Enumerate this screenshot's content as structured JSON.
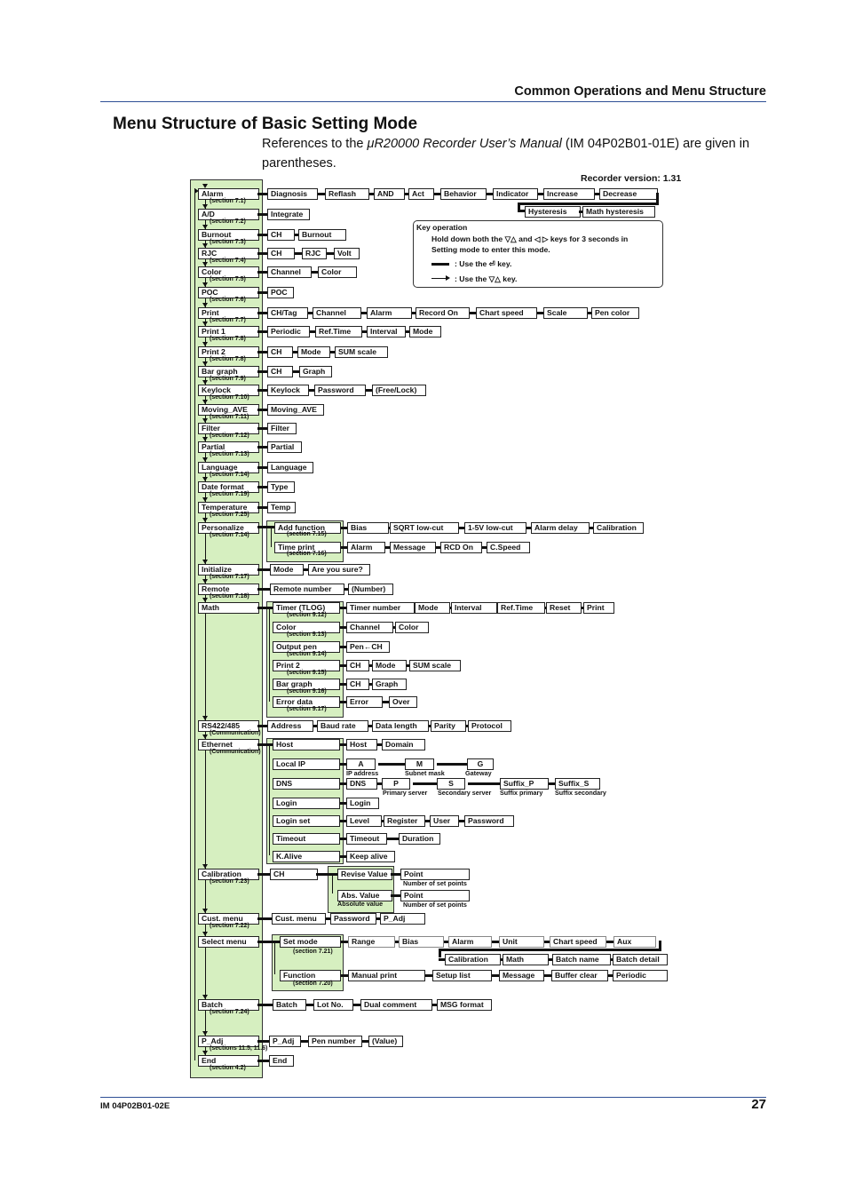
{
  "header": {
    "section_title": "Common Operations and Menu Structure",
    "page_title": "Menu Structure of Basic Setting Mode",
    "intro_prefix": "References to the ",
    "intro_italic": "μR20000 Recorder User’s Manual",
    "intro_suffix": " (IM 04P02B01-01E) are given in parentheses.",
    "recorder_version": "Recorder version: 1.31"
  },
  "key_operation": {
    "title": "Key operation",
    "line1": "Hold down both the ▽△ and ◁ ▷ keys for 3 seconds in",
    "line2": "Setting mode to enter this mode.",
    "thick_legend": ":  Use the ⏎ key.",
    "thin_legend": ":  Use the ▽△ key."
  },
  "menu": {
    "alarm": {
      "label": "Alarm",
      "section": "(section 7.1)",
      "items": [
        "Diagnosis",
        "Reflash",
        "AND",
        "Act",
        "Behavior",
        "Indicator",
        "Increase",
        "Decrease"
      ],
      "items2": [
        "Hysteresis",
        "Math hysteresis"
      ]
    },
    "ad": {
      "label": "A/D",
      "section": "(section 7.2)",
      "items": [
        "Integrate"
      ]
    },
    "burnout": {
      "label": "Burnout",
      "section": "(section 7.3)",
      "items": [
        "CH",
        "Burnout"
      ]
    },
    "rjc": {
      "label": "RJC",
      "section": "(section 7.4)",
      "items": [
        "CH",
        "RJC",
        "Volt"
      ]
    },
    "color": {
      "label": "Color",
      "section": "(section 7.5)",
      "items": [
        "Channel",
        "Color"
      ]
    },
    "poc": {
      "label": "POC",
      "section": "(section 7.6)",
      "items": [
        "POC"
      ]
    },
    "print": {
      "label": "Print",
      "section": "(section 7.7)",
      "items": [
        "CH/Tag",
        "Channel",
        "Alarm",
        "Record On",
        "Chart speed",
        "Scale",
        "Pen color"
      ]
    },
    "print1": {
      "label": "Print 1",
      "section": "(section 7.8)",
      "items": [
        "Periodic",
        "Ref.Time",
        "Interval",
        "Mode"
      ]
    },
    "print2": {
      "label": "Print 2",
      "section": "(section 7.8)",
      "items": [
        "CH",
        "Mode",
        "SUM scale"
      ]
    },
    "bargraph": {
      "label": "Bar graph",
      "section": "(section 7.9)",
      "items": [
        "CH",
        "Graph"
      ]
    },
    "keylock": {
      "label": "Keylock",
      "section": "(section 7.10)",
      "items": [
        "Keylock",
        "Password",
        "(Free/Lock)"
      ]
    },
    "movingave": {
      "label": "Moving_AVE",
      "section": "(section 7.11)",
      "items": [
        "Moving_AVE"
      ]
    },
    "filter": {
      "label": "Filter",
      "section": "(section 7.12)",
      "items": [
        "Filter"
      ]
    },
    "partial": {
      "label": "Partial",
      "section": "(section 7.13)",
      "items": [
        "Partial"
      ]
    },
    "language": {
      "label": "Language",
      "section": "(section 7.14)",
      "items": [
        "Language"
      ]
    },
    "dateformat": {
      "label": "Date format",
      "section": "(section 7.19)",
      "items": [
        "Type"
      ]
    },
    "temperature": {
      "label": "Temperature",
      "section": "(section 7.25)",
      "items": [
        "Temp"
      ]
    },
    "personalize": {
      "label": "Personalize",
      "section": "(section 7.14)",
      "sub": [
        {
          "label": "Add function",
          "section": "(section 7.15)",
          "items": [
            "Bias",
            "SQRT low-cut",
            "1-5V low-cut",
            "Alarm delay",
            "Calibration"
          ]
        },
        {
          "label": "Time print",
          "section": "(section 7.16)",
          "items": [
            "Alarm",
            "Message",
            "RCD On",
            "C.Speed"
          ]
        }
      ]
    },
    "initialize": {
      "label": "Initialize",
      "section": "(section 7.17)",
      "items": [
        "Mode",
        "Are you sure?"
      ]
    },
    "remote": {
      "label": "Remote",
      "section": "(section 7.18)",
      "items": [
        "Remote number",
        "(Number)"
      ]
    },
    "math": {
      "label": "Math",
      "sub": [
        {
          "label": "Timer (TLOG)",
          "section": "(section 9.12)",
          "items": [
            "Timer number",
            "Mode",
            "Interval",
            "Ref.Time",
            "Reset",
            "Print"
          ]
        },
        {
          "label": "Color",
          "section": "(section 9.13)",
          "items": [
            "Channel",
            "Color"
          ]
        },
        {
          "label": "Output pen",
          "section": "(section 9.14)",
          "items": [
            "Pen←CH"
          ]
        },
        {
          "label": "Print 2",
          "section": "(section 9.15)",
          "items": [
            "CH",
            "Mode",
            "SUM scale"
          ]
        },
        {
          "label": "Bar graph",
          "section": "(section 9.16)",
          "items": [
            "CH",
            "Graph"
          ]
        },
        {
          "label": "Error data",
          "section": "(section 9.17)",
          "items": [
            "Error",
            "Over"
          ]
        }
      ]
    },
    "rs422": {
      "label": "RS422/485",
      "section": "(Communication)",
      "items": [
        "Address",
        "Baud rate",
        "Data length",
        "Parity",
        "Protocol"
      ]
    },
    "ethernet": {
      "label": "Ethernet",
      "section": "(Communication)",
      "sub": [
        {
          "label": "Host",
          "items": [
            "Host",
            "Domain"
          ]
        },
        {
          "label": "Local IP",
          "items": [
            "A",
            "M",
            "G"
          ],
          "captions": [
            "IP address",
            "Subnet mask",
            "Gateway"
          ]
        },
        {
          "label": "DNS",
          "items": [
            "DNS",
            "P",
            "S",
            "Suffix_P",
            "Suffix_S"
          ],
          "captions": [
            "Primary server",
            "Secondary server",
            "Suffix primary",
            "Suffix secondary"
          ]
        },
        {
          "label": "Login",
          "items": [
            "Login"
          ]
        },
        {
          "label": "Login set",
          "items": [
            "Level",
            "Register",
            "User",
            "Password"
          ]
        },
        {
          "label": "Timeout",
          "items": [
            "Timeout",
            "Duration"
          ]
        },
        {
          "label": "K.Alive",
          "items": [
            "Keep alive"
          ]
        }
      ]
    },
    "calibration": {
      "label": "Calibration",
      "section": "(section 7.23)",
      "items": [
        "CH"
      ],
      "sub": [
        {
          "label": "Revise Value",
          "items": [
            "Point"
          ],
          "caption": "Number of set points"
        },
        {
          "label": "Abs. Value",
          "items": [
            "Point"
          ],
          "caption": "Number of set points",
          "sub_caption": "Absolute value"
        }
      ]
    },
    "custmenu": {
      "label": "Cust. menu",
      "section": "(section 7.22)",
      "items": [
        "Cust. menu",
        "Password",
        "P_Adj"
      ]
    },
    "selectmenu": {
      "label": "Select menu",
      "sub": [
        {
          "label": "Set mode",
          "section": "(section 7.21)",
          "items": [
            "Range",
            "Bias",
            "Alarm",
            "Unit",
            "Chart speed",
            "Aux"
          ],
          "items2": [
            "Calibration",
            "Math",
            "Batch name",
            "Batch detail"
          ]
        },
        {
          "label": "Function",
          "section": "(section 7.20)",
          "items": [
            "Manual print",
            "Setup list",
            "Message",
            "Buffer clear",
            "Periodic"
          ]
        }
      ]
    },
    "batch": {
      "label": "Batch",
      "section": "(section 7.24)",
      "items": [
        "Batch",
        "Lot No.",
        "Dual comment",
        "MSG format"
      ]
    },
    "padj": {
      "label": "P_Adj",
      "section": "(sections 11.5, 11.6)",
      "items": [
        "P_Adj",
        "Pen number",
        "(Value)"
      ]
    },
    "end": {
      "label": "End",
      "section": "(section 4.2)",
      "items": [
        "End"
      ]
    }
  },
  "footer": {
    "doc_id": "IM 04P02B01-02E",
    "page_number": "27"
  }
}
